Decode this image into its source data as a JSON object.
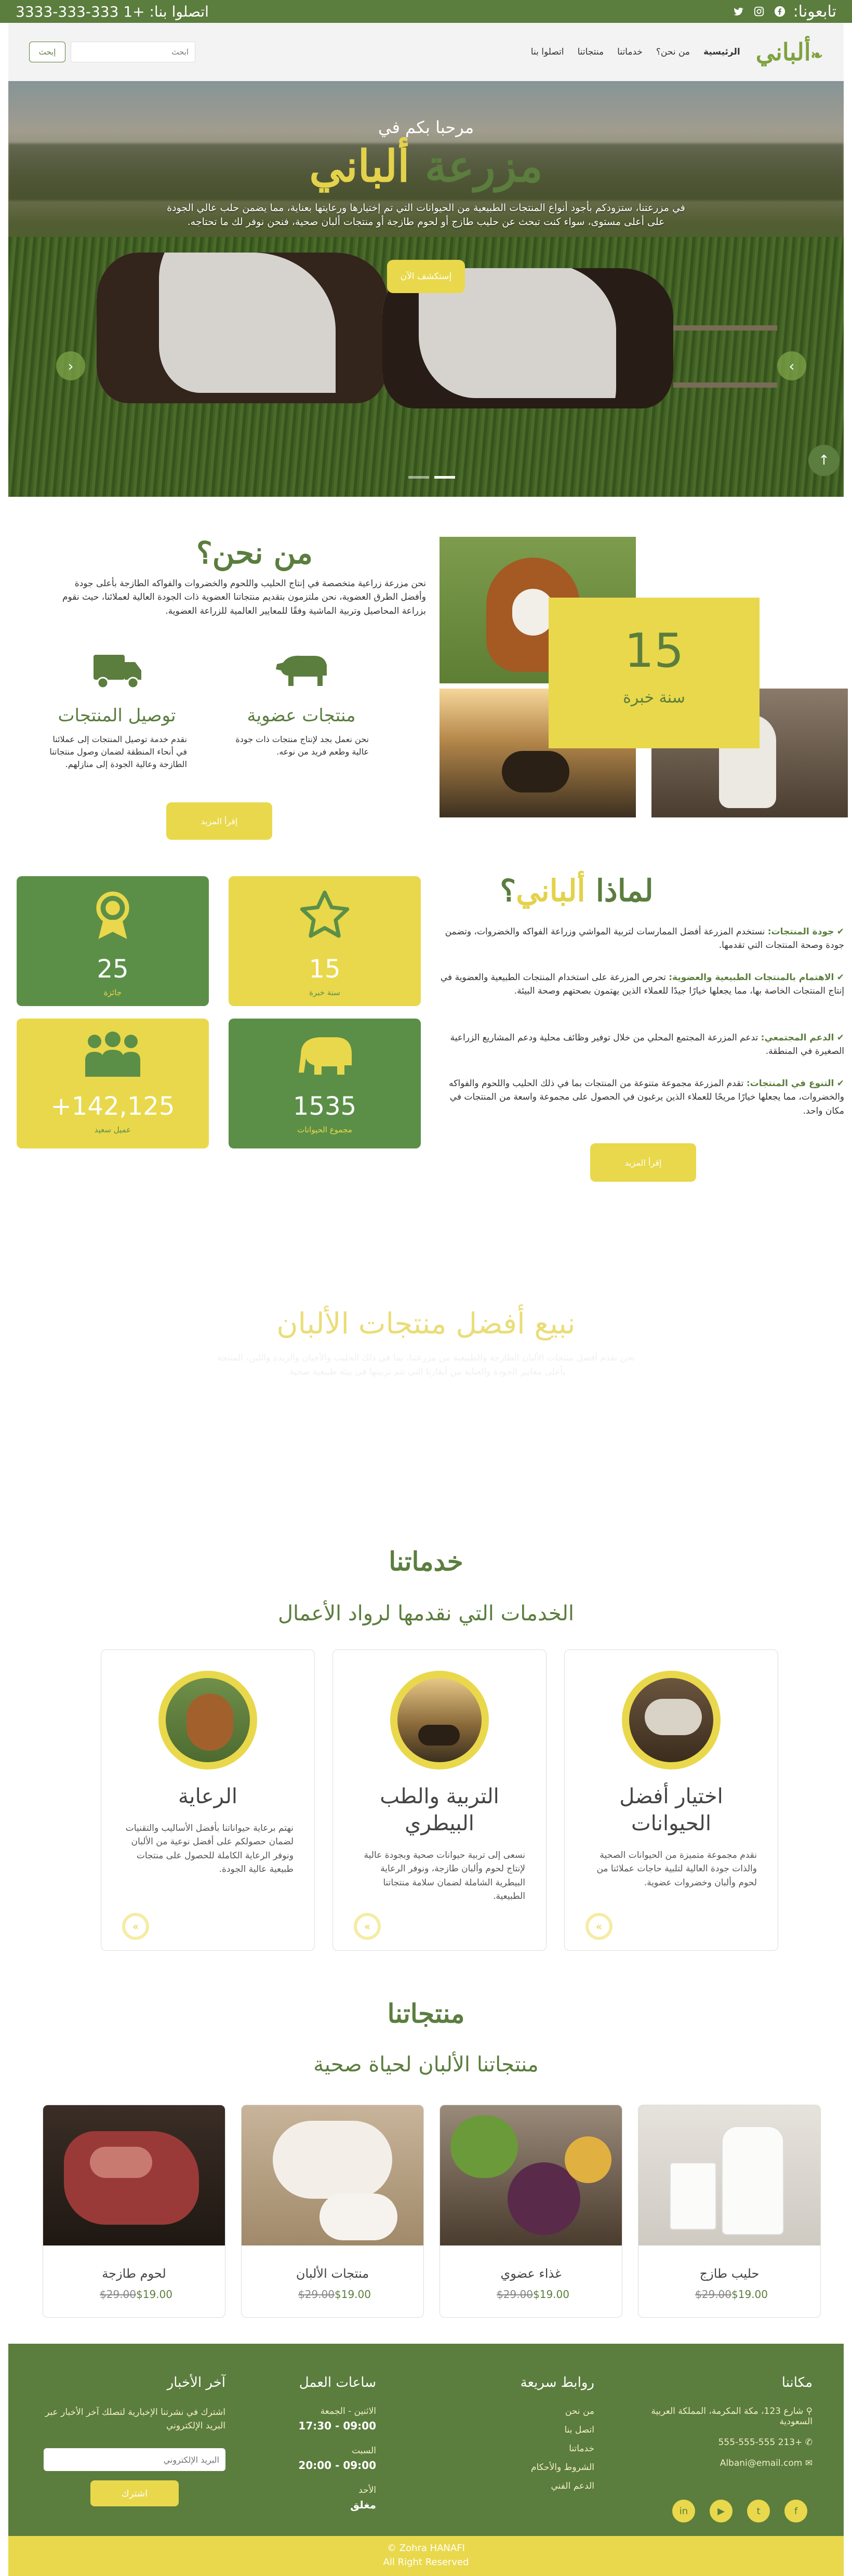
{
  "topbar": {
    "follow_label": "تابعونا:",
    "contact_label": "اتصلوا بنا: +1 333-333-3333",
    "social_icons": [
      "facebook-icon",
      "instagram-icon",
      "twitter-icon"
    ]
  },
  "nav": {
    "logo_main": "ألباني",
    "items": [
      "الرئيسية",
      "من نحن؟",
      "خدماتنا",
      "منتجاتنا",
      "اتصلوا بنا"
    ],
    "search_placeholder": "ابحث",
    "search_button": "إبحث"
  },
  "hero": {
    "welcome": "مرحبا بكم في",
    "title_part1": "مزرعة",
    "title_part2": "ألباني",
    "description": "في مزرعتنا، ستزودكم بأجود أنواع المنتجات الطبيعية من الحيوانات التي تم إختيارها ورعايتها بعناية، مما يضمن حلب عالي الجودة على أعلى مستوى، سواء كنت تبحث عن حليب طازج أو لحوم طازجة أو منتجات ألبان صحية، فنحن نوفر لك ما تحتاجه.",
    "cta": "إستكشف الآن"
  },
  "about": {
    "heading_part1": "من",
    "heading_part2": "نحن؟",
    "intro": "نحن مزرعة زراعية متخصصة في إنتاج الحليب واللحوم والخضروات والفواكه الطازجة بأعلى جودة وأفضل الطرق العضوية، نحن ملتزمون بتقديم منتجاتنا العضوية ذات الجودة العالية لعملائنا، حيث نقوم بزراعة المحاصيل وتربية الماشية وفقًا للمعايير العالمية للزراعة العضوية.",
    "features": [
      {
        "title": "منتجات عضوية",
        "text": "نحن نعمل بجد لإنتاج منتجات ذات جودة عالية وطعم فريد من نوعه."
      },
      {
        "title": "توصيل المنتجات",
        "text": "نقدم خدمة توصيل المنتجات إلى عملائنا في أنحاء المنطقة لضمان وصول منتجاتنا الطازجة وعالية الجودة إلى منازلهم."
      }
    ],
    "more_button": "إقرأ المزيد",
    "experience_number": "15",
    "experience_label": "سنة خبرة"
  },
  "why": {
    "heading_part1": "لماذا",
    "heading_part2": "ألباني",
    "heading_q": "؟",
    "items": [
      {
        "title": "جودة المنتجات:",
        "text": "نستخدم المزرعة أفضل الممارسات لتربية المواشي وزراعة الفواكه والخضروات، وتضمن جودة وصحة المنتجات التي تقدمها."
      },
      {
        "title": "الاهتمام بالمنتجات الطبيعية والعضوية:",
        "text": "تحرص المزرعة على استخدام المنتجات الطبيعية والعضوية في إنتاج المنتجات الخاصة بها، مما يجعلها خيارًا جيدًا للعملاء الذين يهتمون بصحتهم وصحة البيئة."
      },
      {
        "title": "الدعم المجتمعي:",
        "text": "تدعم المزرعة المجتمع المحلي من خلال توفير وظائف محلية ودعم المشاريع الزراعية الصغيرة في المنطقة."
      },
      {
        "title": "التنوع في المنتجات:",
        "text": "تقدم المزرعة مجموعة متنوعة من المنتجات بما في ذلك الحليب واللحوم والفواكه والخضروات، مما يجعلها خيارًا مريحًا للعملاء الذين يرغبون في الحصول على مجموعة واسعة من المنتجات في مكان واحد."
      }
    ],
    "more_button": "إقرأ المزيد",
    "stats": [
      {
        "value": "15",
        "label": "سنة خبرة",
        "icon": "star-icon"
      },
      {
        "value": "25",
        "label": "جائزة",
        "icon": "award-icon"
      },
      {
        "value": "1535",
        "label": "مجموع الحيوانات",
        "icon": "elephant-icon"
      },
      {
        "value": "142,125+",
        "label": "عميل سعيد",
        "icon": "people-icon"
      }
    ]
  },
  "sell": {
    "title": "نبيع أفضل منتجات الألبان",
    "text": "نحن نقدم أفضل منتجات الألبان الطازجة والطبيعية من مزرعتنا، بما في ذلك الحليب والأجبان والزبدة واللبن، المنتجة بأعلى معايير الجودة والعناية من أبقارنا التي تتم تربيتها في بيئة طبيعية صحية."
  },
  "services": {
    "script_heading": "خدماتنا",
    "subheading": "الخدمات التي نقدمها لرواد الأعمال",
    "cards": [
      {
        "title": "اختيار أفضل الحيوانات",
        "text": "نقدم مجموعة متميزة من الحيوانات الصحية والذات جودة العالية لتلبية حاجات عملائنا من لحوم وألبان وخضروات عضوية."
      },
      {
        "title": "التربية والطب البيطري",
        "text": "نسعى إلى تربية حيوانات صحية وبجودة عالية لإنتاج لحوم وألبان طازجة، ونوفر الرعاية البيطرية الشاملة لضمان سلامة منتجاتنا الطبيعية."
      },
      {
        "title": "الرعاية",
        "text": "نهتم برعاية حيواناتنا بأفضل الأساليب والتقنيات لضمان حصولكم على أفضل نوعية من الألبان ونوفر الرعاية الكاملة للحصول على منتجات طبيعية عالية الجودة."
      }
    ]
  },
  "products": {
    "script_heading": "منتجاتنا",
    "subheading": "منتجاتنا الألبان لحياة صحية",
    "items": [
      {
        "name": "حليب طازج",
        "old_price": "$29.00",
        "price": "$19.00"
      },
      {
        "name": "غذاء عضوي",
        "old_price": "$29.00",
        "price": "$19.00"
      },
      {
        "name": "منتجات الألبان",
        "old_price": "$29.00",
        "price": "$19.00"
      },
      {
        "name": "لحوم طازجة",
        "old_price": "$29.00",
        "price": "$19.00"
      }
    ]
  },
  "footer": {
    "location_title": "مكاننا",
    "address": "شارع 123، مكة المكرمة، المملكة العربية السعودية",
    "phone": "+213 555-555-555",
    "email": "Albani@email.com",
    "links_title": "روابط سريعة",
    "links": [
      "من نحن",
      "اتصل بنا",
      "خدماتنا",
      "الشروط والأحكام",
      "الدعم الفني"
    ],
    "hours_title": "ساعات العمل",
    "hours": [
      {
        "day": "الاثنين - الجمعة",
        "time": "09:00 - 17:30"
      },
      {
        "day": "السبت",
        "time": "09:00 - 20:00"
      },
      {
        "day": "الأحد",
        "time": "مغلق"
      }
    ],
    "news_title": "آخر الأخبار",
    "news_text": "اشترك في نشرتنا الإخبارية لتصلك آخر الأخبار عبر البريد الإلكتروني",
    "news_placeholder": "البريد الإلكتروني",
    "news_button": "اشترك",
    "copyright_name": "Zohra HANAFI ©",
    "copyright_text": "All Right Reserved"
  },
  "colors": {
    "green": "#5b7d3e",
    "yellow": "#e9d84b"
  }
}
